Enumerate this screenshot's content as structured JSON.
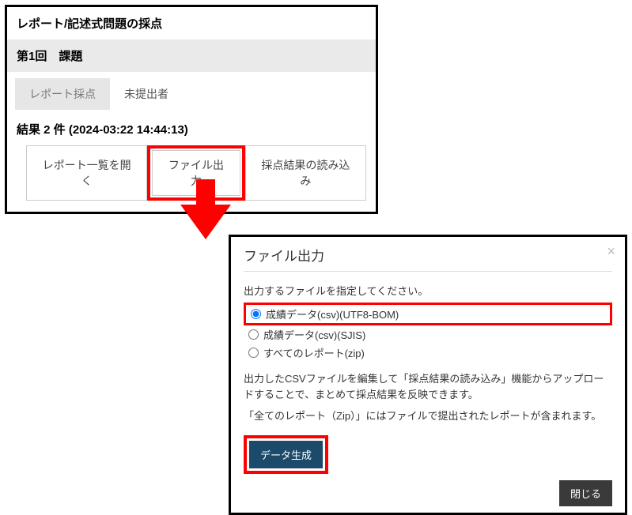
{
  "panel1": {
    "header": "レポート/記述式問題の採点",
    "subheader": "第1回　課題",
    "tabs": {
      "active": "レポート採点",
      "other": "未提出者"
    },
    "results_label": "結果 2 件 (2024-03:22 14:44:13)",
    "buttons": {
      "open_list": "レポート一覧を開く",
      "file_output": "ファイル出力",
      "import_results": "採点結果の読み込み"
    }
  },
  "modal": {
    "title": "ファイル出力",
    "instruction": "出力するファイルを指定してください。",
    "options": {
      "utf8": "成績データ(csv)(UTF8-BOM)",
      "sjis": "成績データ(csv)(SJIS)",
      "zip": "すべてのレポート(zip)"
    },
    "para1": "出力したCSVファイルを編集して「採点結果の読み込み」機能からアップロードすることで、まとめて採点結果を反映できます。",
    "para2": "「全てのレポート（Zip）」にはファイルで提出されたレポートが含まれます。",
    "generate_btn": "データ生成",
    "close_btn": "閉じる"
  }
}
